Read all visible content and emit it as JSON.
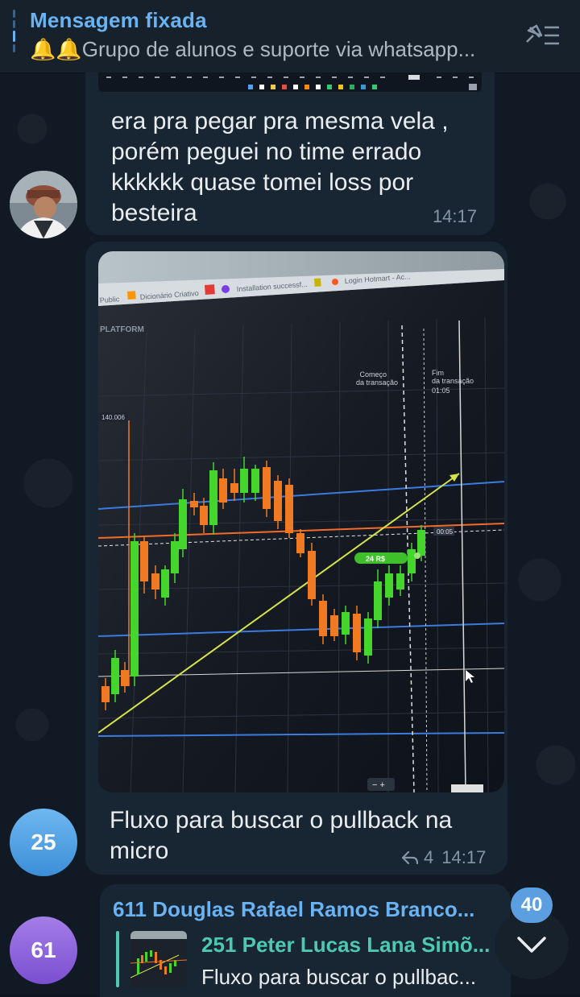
{
  "pinned": {
    "title": "Mensagem fixada",
    "text": "🔔🔔Grupo de alunos e suporte via whatsapp..."
  },
  "messages": [
    {
      "text": "era pra pegar pra mesma vela , porém peguei no time errado kkkkkk quase tomei loss por besteira",
      "time": "14:17"
    },
    {
      "caption": "Fluxo para buscar o pullback na micro",
      "replies": "4",
      "time": "14:17"
    }
  ],
  "avatars": {
    "second": "25",
    "third": "61"
  },
  "last_message": {
    "reply_name": "611 Douglas Rafael Ramos Branco...",
    "forward_name": "251 Peter Lucas Lana Simõ...",
    "forward_text": "Fluxo para buscar o pullbac..."
  },
  "photo": {
    "tabs": [
      "Public",
      "Dicionário Criativo",
      "Installation successf...",
      "Login Hotmart - Ac..."
    ],
    "platform_label": "PLATFORM",
    "start_label": "Começo da transação",
    "end_label": "Fim da transação 01:05",
    "price_tag": "140.006",
    "trade_tag": "24 R$",
    "timer_tag": "00:05"
  },
  "unread_count": "40",
  "colors": {
    "accent": "#6ab3f3",
    "bubble": "#182533",
    "avatar_25": "#4a9fe0",
    "avatar_61": "#8c62d8",
    "candle_up": "#44d62c",
    "candle_down": "#f07a23"
  }
}
